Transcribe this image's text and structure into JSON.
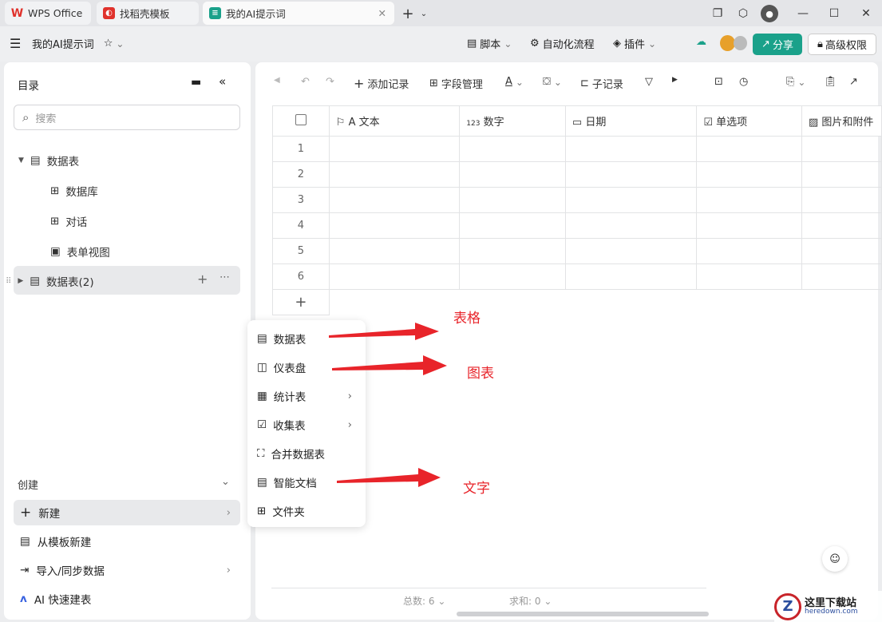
{
  "tabs": [
    {
      "label": "WPS Office"
    },
    {
      "label": "找稻壳模板"
    },
    {
      "label": "我的AI提示词"
    }
  ],
  "doc_title": "我的AI提示词",
  "appbar": {
    "script": "脚本",
    "automation": "自动化流程",
    "plugin": "插件",
    "share": "分享",
    "permission": "高级权限"
  },
  "sidebar": {
    "title": "目录",
    "search_placeholder": "搜索",
    "tree": [
      {
        "label": "数据表"
      },
      {
        "label": "数据库"
      },
      {
        "label": "对话"
      },
      {
        "label": "表单视图"
      },
      {
        "label": "数据表(2)"
      }
    ],
    "create_title": "创建",
    "create_items": [
      {
        "label": "新建"
      },
      {
        "label": "从模板新建"
      },
      {
        "label": "导入/同步数据"
      },
      {
        "label": "AI 快速建表"
      }
    ]
  },
  "toolbar": {
    "add_record": "添加记录",
    "field_manage": "字段管理",
    "sub_record": "子记录"
  },
  "grid": {
    "columns": [
      {
        "label": "A 文本",
        "icon": "flag-icon"
      },
      {
        "label": "数字",
        "prefix": "123"
      },
      {
        "label": "日期"
      },
      {
        "label": "单选项"
      },
      {
        "label": "图片和附件"
      }
    ],
    "rows": [
      "1",
      "2",
      "3",
      "4",
      "5",
      "6"
    ],
    "add": "+"
  },
  "menu": [
    {
      "label": "数据表"
    },
    {
      "label": "仪表盘"
    },
    {
      "label": "统计表"
    },
    {
      "label": "收集表"
    },
    {
      "label": "合并数据表"
    },
    {
      "label": "智能文档"
    },
    {
      "label": "文件夹"
    }
  ],
  "annotations": {
    "table": "表格",
    "chart": "图表",
    "text": "文字"
  },
  "footer": {
    "total": "总数: 6",
    "sum": "求和: 0"
  },
  "watermark": {
    "text": "这里下载站",
    "url": "heredown.com"
  },
  "colors": {
    "accent": "#1aa18a",
    "annotation": "#e8242a"
  }
}
